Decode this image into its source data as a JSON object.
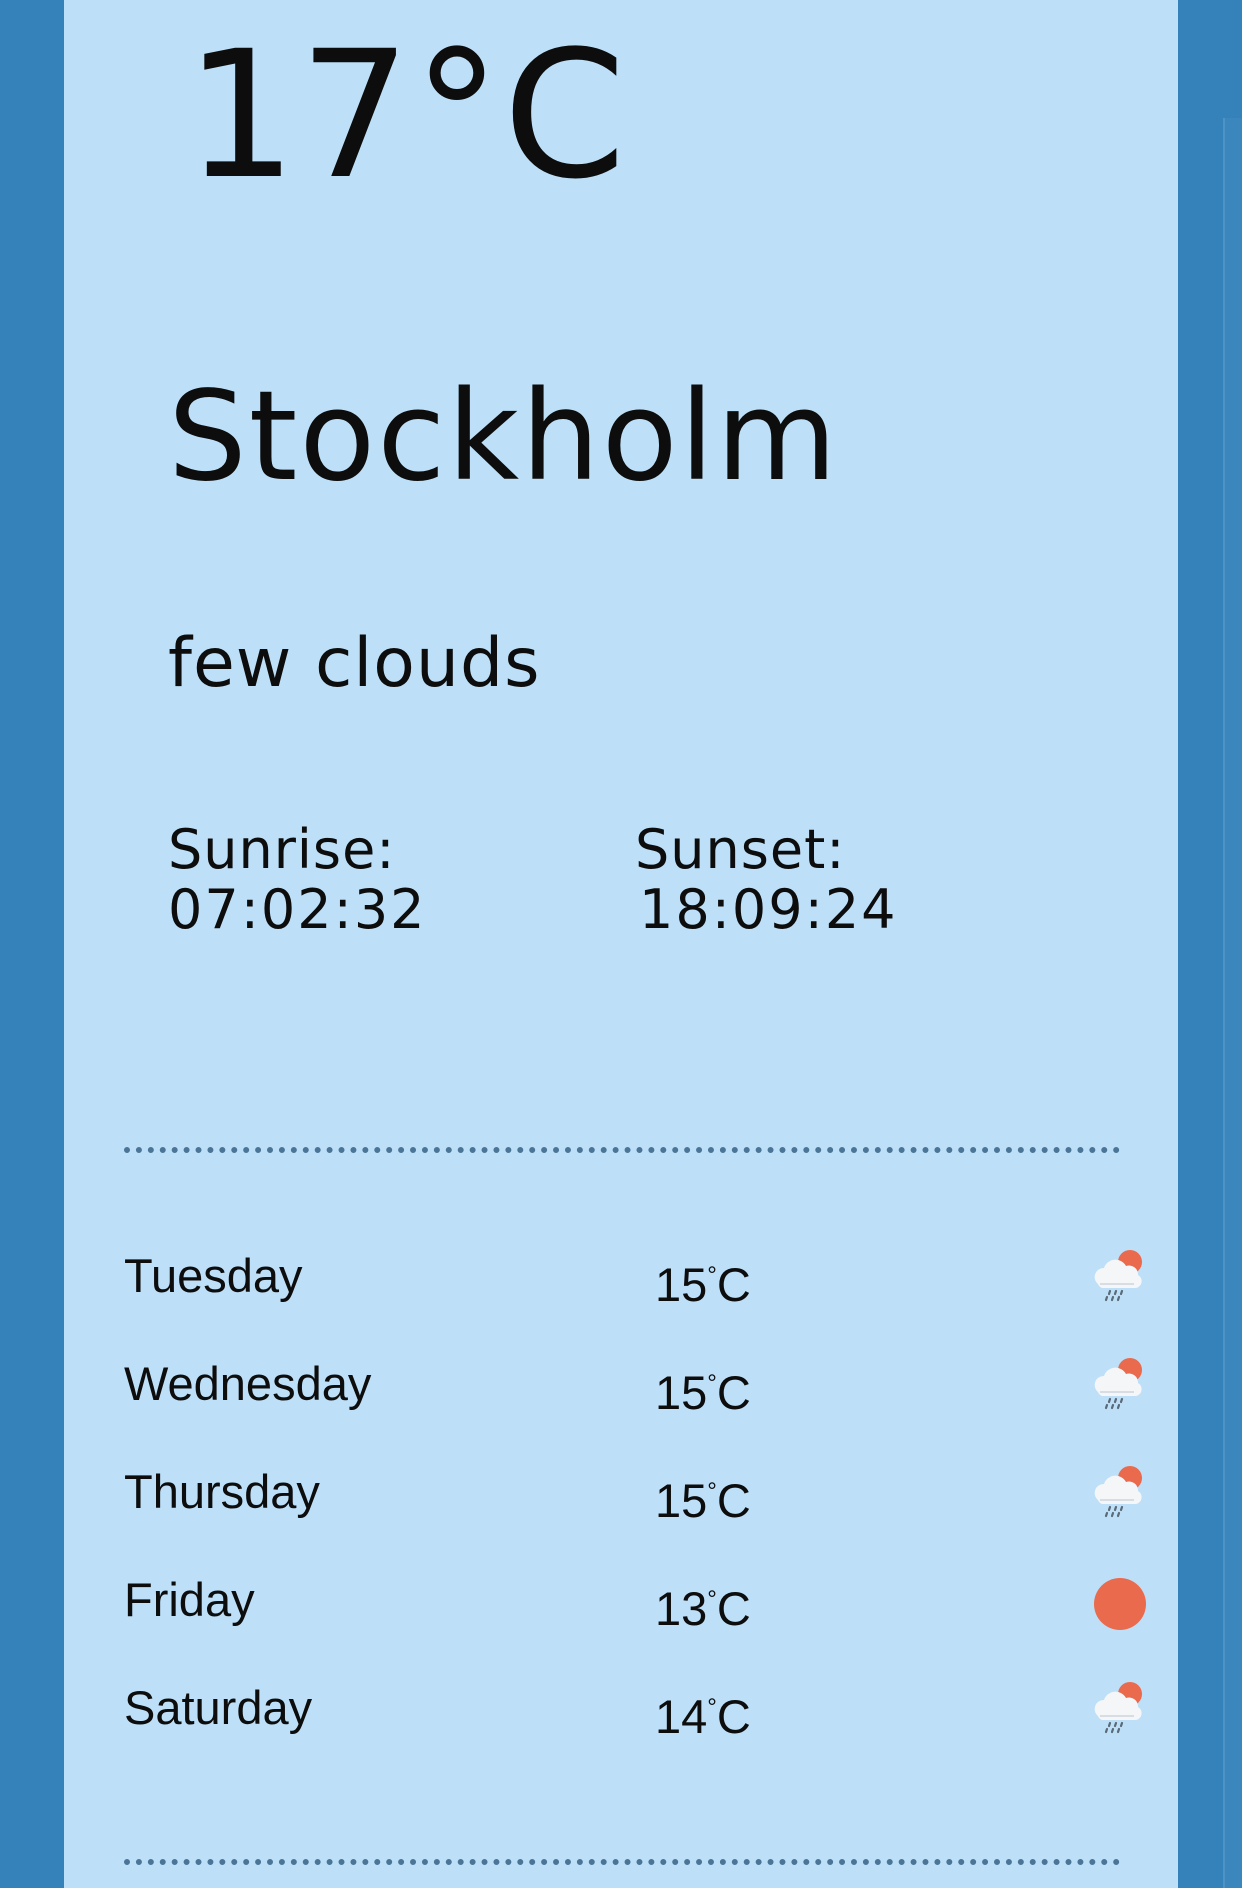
{
  "current": {
    "temperature": "17°C",
    "city": "Stockholm",
    "description": "few clouds"
  },
  "sun": {
    "sunrise_label": "Sunrise:",
    "sunrise_time": "07:02:32",
    "sunset_label": "Sunset:",
    "sunset_time": "18:09:24"
  },
  "colors": {
    "background": "#3582ba",
    "card": "#bde0f8",
    "sun_accent": "#ea6a4e",
    "divider": "#4a7596"
  },
  "forecast": [
    {
      "day": "Tuesday",
      "temp": "15",
      "unit": "°",
      "scale": "C",
      "icon": "rain-sun-cloud-icon"
    },
    {
      "day": "Wednesday",
      "temp": "15",
      "unit": "°",
      "scale": "C",
      "icon": "rain-sun-cloud-icon"
    },
    {
      "day": "Thursday",
      "temp": "15",
      "unit": "°",
      "scale": "C",
      "icon": "rain-sun-cloud-icon"
    },
    {
      "day": "Friday",
      "temp": "13",
      "unit": "°",
      "scale": "C",
      "icon": "sun-icon"
    },
    {
      "day": "Saturday",
      "temp": "14",
      "unit": "°",
      "scale": "C",
      "icon": "rain-sun-cloud-icon"
    }
  ]
}
